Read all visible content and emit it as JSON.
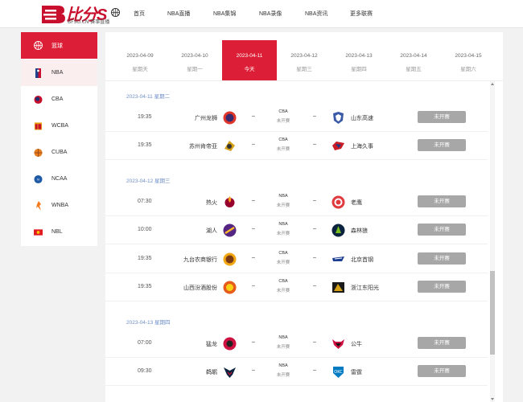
{
  "header": {
    "logo_text": "比分S",
    "logo_sub": "BFSO.CN 赛事直播",
    "nav": [
      "首页",
      "NBA直播",
      "NBA集锦",
      "NBA录像",
      "NBA资讯",
      "更多联赛"
    ]
  },
  "sidebar": {
    "items": [
      {
        "label": "篮球",
        "icon": "basketball-icon",
        "state": "active"
      },
      {
        "label": "NBA",
        "icon": "nba-logo-icon",
        "state": "selected"
      },
      {
        "label": "CBA",
        "icon": "cba-logo-icon",
        "state": ""
      },
      {
        "label": "WCBA",
        "icon": "wcba-logo-icon",
        "state": ""
      },
      {
        "label": "CUBA",
        "icon": "cuba-logo-icon",
        "state": ""
      },
      {
        "label": "NCAA",
        "icon": "ncaa-logo-icon",
        "state": ""
      },
      {
        "label": "WNBA",
        "icon": "wnba-logo-icon",
        "state": ""
      },
      {
        "label": "NBL",
        "icon": "nbl-logo-icon",
        "state": ""
      }
    ]
  },
  "dates": [
    {
      "date": "2023-04-09",
      "weekday": "星期天",
      "active": false
    },
    {
      "date": "2023-04-10",
      "weekday": "星期一",
      "active": false
    },
    {
      "date": "2023-04-11",
      "weekday": "今天",
      "active": true
    },
    {
      "date": "2023-04-12",
      "weekday": "星期三",
      "active": false
    },
    {
      "date": "2023-04-13",
      "weekday": "星期四",
      "active": false
    },
    {
      "date": "2023-04-14",
      "weekday": "星期五",
      "active": false
    },
    {
      "date": "2023-04-15",
      "weekday": "星期六",
      "active": false
    }
  ],
  "days": [
    {
      "header": "2023-04-11 星期二",
      "matches": [
        {
          "time": "19:35",
          "home": "广州龙狮",
          "league": "CBA",
          "state": "未开赛",
          "away": "山东高速",
          "button": "未开赛",
          "home_color": "#e0352b",
          "away_color": "#3a5aa8"
        },
        {
          "time": "19:35",
          "home": "苏州肯帝亚",
          "league": "CBA",
          "state": "未开赛",
          "away": "上海久事",
          "button": "未开赛",
          "home_color": "#d4a017",
          "away_color": "#c81d25"
        }
      ]
    },
    {
      "header": "2023-04-12 星期三",
      "matches": [
        {
          "time": "07:30",
          "home": "热火",
          "league": "NBA",
          "state": "未开赛",
          "away": "老鹰",
          "button": "未开赛",
          "home_color": "#98002e",
          "away_color": "#e03a3e"
        },
        {
          "time": "10:00",
          "home": "湖人",
          "league": "NBA",
          "state": "未开赛",
          "away": "森林狼",
          "button": "未开赛",
          "home_color": "#552583",
          "away_color": "#0c2340"
        },
        {
          "time": "19:35",
          "home": "九台农商银行",
          "league": "CBA",
          "state": "未开赛",
          "away": "北京首钢",
          "button": "未开赛",
          "home_color": "#f3a712",
          "away_color": "#1c3f94"
        },
        {
          "time": "19:35",
          "home": "山西汾酒股份",
          "league": "CBA",
          "state": "未开赛",
          "away": "浙江东阳光",
          "button": "未开赛",
          "home_color": "#e85a1b",
          "away_color": "#1a1a1a"
        }
      ]
    },
    {
      "header": "2023-04-13 星期四",
      "matches": [
        {
          "time": "07:00",
          "home": "猛龙",
          "league": "NBA",
          "state": "未开赛",
          "away": "公牛",
          "button": "未开赛",
          "home_color": "#ce1141",
          "away_color": "#ce1141"
        },
        {
          "time": "09:30",
          "home": "鹈鹕",
          "league": "NBA",
          "state": "未开赛",
          "away": "雷霆",
          "button": "未开赛",
          "home_color": "#0c2340",
          "away_color": "#007ac1"
        }
      ]
    }
  ],
  "colors": {
    "accent": "#dc1f36",
    "day_header": "#6e8ec8",
    "button": "#a7a7a7"
  }
}
